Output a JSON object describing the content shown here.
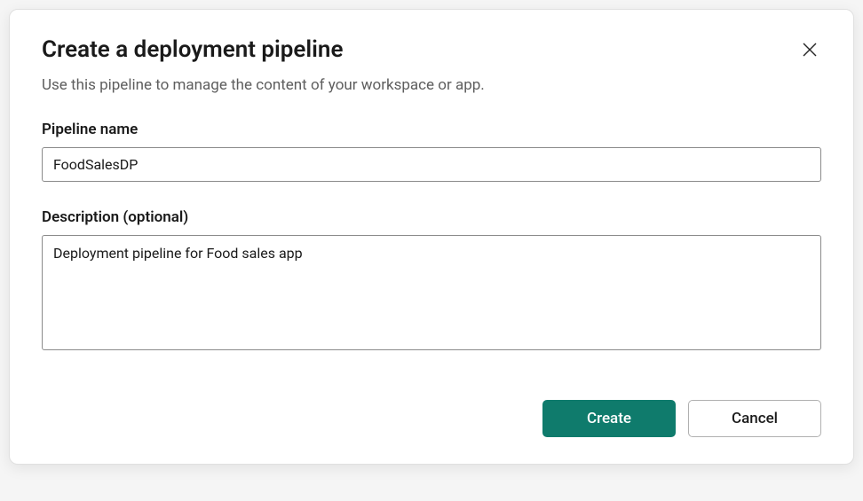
{
  "dialog": {
    "title": "Create a deployment pipeline",
    "subtitle": "Use this pipeline to manage the content of your workspace or app."
  },
  "form": {
    "pipelineName": {
      "label": "Pipeline name",
      "value": "FoodSalesDP"
    },
    "description": {
      "label": "Description (optional)",
      "value": "Deployment pipeline for Food sales app"
    }
  },
  "actions": {
    "create": "Create",
    "cancel": "Cancel"
  },
  "colors": {
    "primary": "#0F7B6C"
  }
}
